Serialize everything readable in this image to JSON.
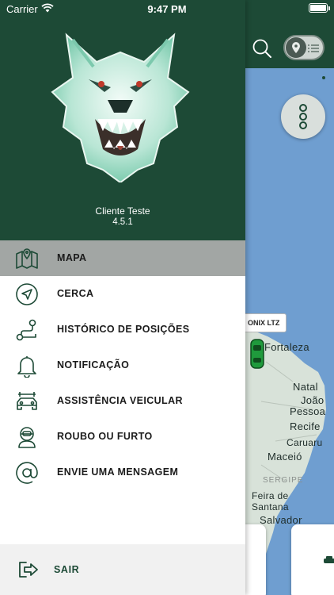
{
  "status_bar": {
    "carrier": "Carrier",
    "time": "9:47 PM"
  },
  "drawer": {
    "client_name": "Cliente Teste",
    "version": "4.5.1",
    "menu": [
      {
        "label": "MAPA",
        "icon": "map-icon",
        "active": true
      },
      {
        "label": "CERCA",
        "icon": "navigation-arrow-icon",
        "active": false
      },
      {
        "label": "HISTÓRICO DE POSIÇÕES",
        "icon": "route-icon",
        "active": false
      },
      {
        "label": "NOTIFICAÇÃO",
        "icon": "bell-icon",
        "active": false
      },
      {
        "label": "ASSISTÊNCIA VEICULAR",
        "icon": "car-assistance-icon",
        "active": false
      },
      {
        "label": "ROUBO OU FURTO",
        "icon": "thief-alert-icon",
        "active": false
      },
      {
        "label": "ENVIE UMA MENSAGEM",
        "icon": "at-sign-icon",
        "active": false
      }
    ],
    "logout_label": "SAIR"
  },
  "map": {
    "vehicle_label": "ONIX LTZ",
    "cities": [
      "Fortaleza",
      "Natal",
      "João",
      "Pessoa",
      "Recife",
      "Caruaru",
      "Maceió",
      "SERGIPE",
      "Feira de",
      "Santana",
      "Salvador"
    ]
  },
  "colors": {
    "primary": "#1d4a36",
    "active_item": "#a2a6a4",
    "map_water": "#6f9ed0",
    "map_land": "#d8e2d9"
  }
}
